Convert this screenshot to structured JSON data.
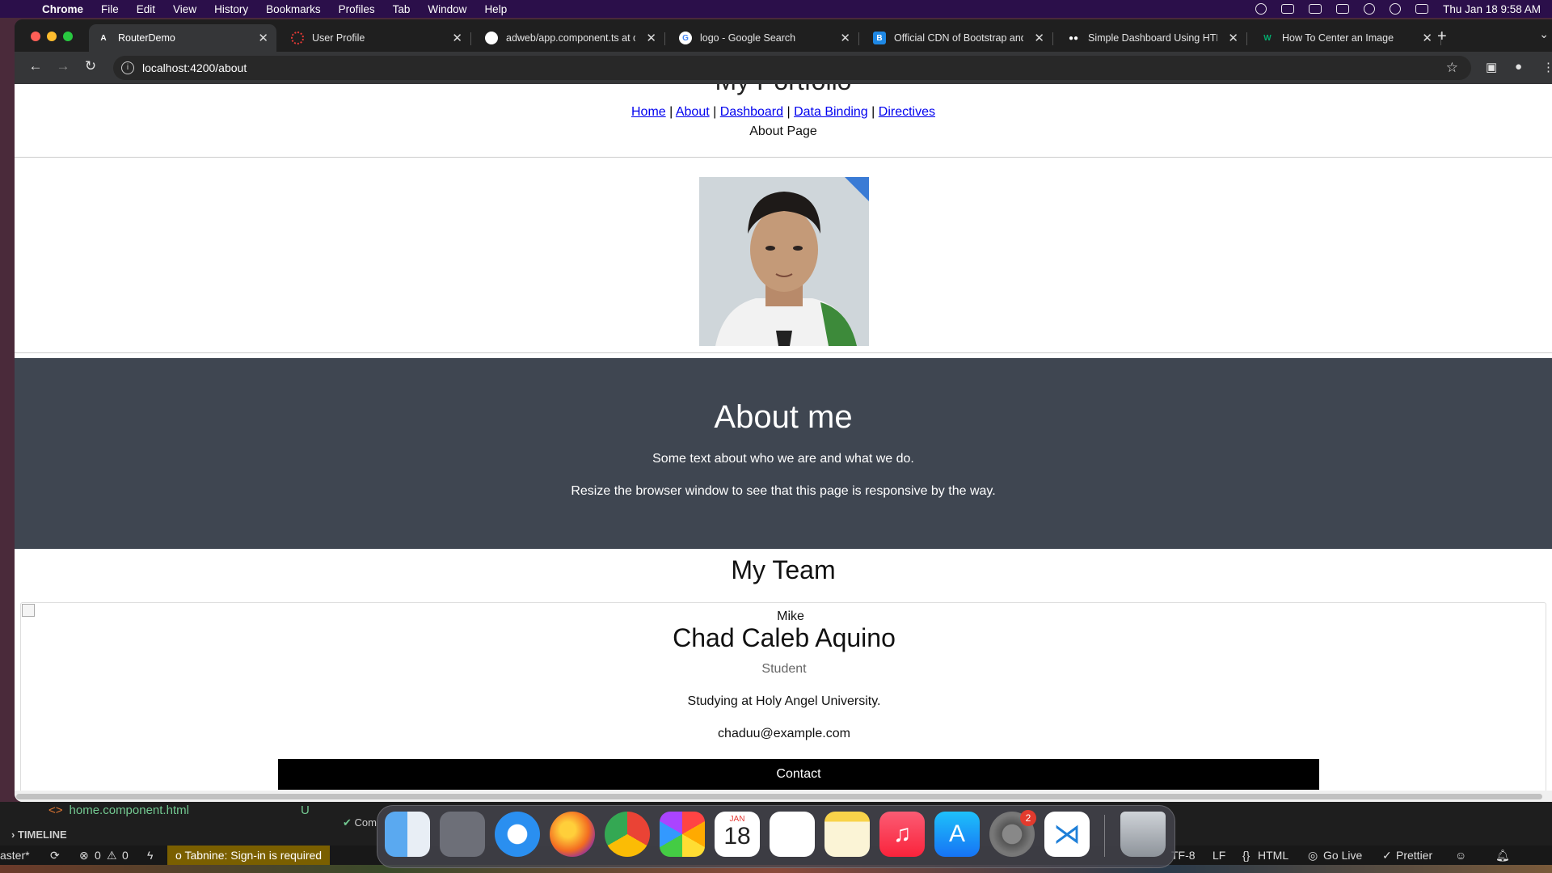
{
  "menubar": {
    "app": "Chrome",
    "items": [
      "File",
      "Edit",
      "View",
      "History",
      "Bookmarks",
      "Profiles",
      "Tab",
      "Window",
      "Help"
    ],
    "datetime": "Thu Jan 18  9:58 AM"
  },
  "tabs": [
    {
      "title": "RouterDemo",
      "favicon": "angular-icon",
      "color": "#353638"
    },
    {
      "title": "User Profile",
      "favicon": "loading-spinner-icon",
      "color": "#e53935"
    },
    {
      "title": "adweb/app.component.ts at c",
      "favicon": "github-icon",
      "color": "#ffffff"
    },
    {
      "title": "logo - Google Search",
      "favicon": "google-icon",
      "color": "#ffffff"
    },
    {
      "title": "Official CDN of Bootstrap and",
      "favicon": "bootstrap-icon",
      "color": "#1e88e5"
    },
    {
      "title": "Simple Dashboard Using HTM",
      "favicon": "medium-icon",
      "color": "#000000"
    },
    {
      "title": "How To Center an Image",
      "favicon": "w3schools-icon",
      "color": "#04aa6d"
    }
  ],
  "address_bar": {
    "url": "localhost:4200/about"
  },
  "page": {
    "site_title": "My Portfolio",
    "nav": [
      {
        "label": "Home"
      },
      {
        "label": "About"
      },
      {
        "label": "Dashboard"
      },
      {
        "label": "Data Binding"
      },
      {
        "label": "Directives"
      }
    ],
    "nav_separator": "|",
    "route_text": "About Page",
    "about": {
      "heading": "About me",
      "line1": "Some text about who we are and what we do.",
      "line2": "Resize the browser window to see that this page is responsive by the way."
    },
    "team_title": "My Team",
    "card": {
      "image_alt": "Mike",
      "name": "Chad Caleb Aquino",
      "role": "Student",
      "bio": "Studying at Holy Angel University.",
      "email": "chaduu@example.com",
      "button": "Contact"
    }
  },
  "vscode": {
    "file": "home.component.html",
    "file_status": "U",
    "timeline": "TIMELINE",
    "branch": "aster*",
    "errors": "0",
    "warnings": "0",
    "tabnine": "Tabnine: Sign-in is required",
    "encoding": "TF-8",
    "eol": "LF",
    "language": "HTML",
    "golive": "Go Live",
    "prettier": "Prettier",
    "terminal_fragment": "Com"
  },
  "dock": {
    "calendar_month": "JAN",
    "calendar_day": "18",
    "settings_badge": "2"
  }
}
